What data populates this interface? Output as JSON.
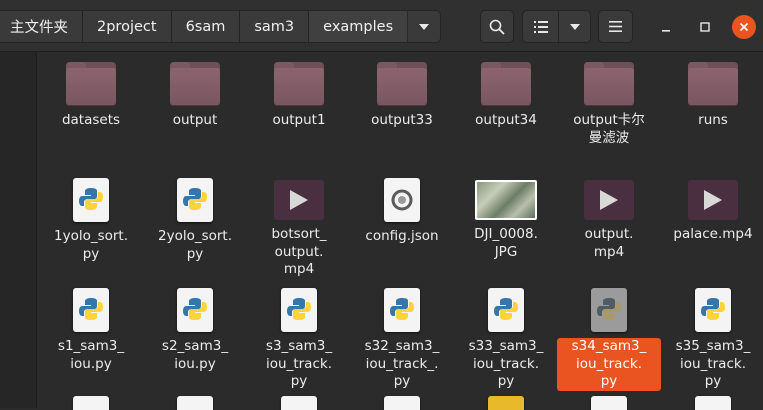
{
  "breadcrumb": {
    "items": [
      "主文件夹",
      "2project",
      "6sam",
      "sam3",
      "examples"
    ]
  },
  "toolbar": {
    "search_icon": "search-icon",
    "view_icon": "list-view-icon",
    "view_menu_icon": "chevron-down-icon",
    "menu_icon": "hamburger-menu-icon"
  },
  "window": {
    "close_color": "#e95420"
  },
  "files": {
    "row1": [
      {
        "name": "datasets",
        "type": "folder"
      },
      {
        "name": "output",
        "type": "folder"
      },
      {
        "name": "output1",
        "type": "folder"
      },
      {
        "name": "output33",
        "type": "folder"
      },
      {
        "name": "output34",
        "type": "folder"
      },
      {
        "name": "output卡尔曼滤波",
        "type": "folder"
      },
      {
        "name": "runs",
        "type": "folder"
      }
    ],
    "row2": [
      {
        "name": "1yolo_sort.py",
        "type": "python"
      },
      {
        "name": "2yolo_sort.py",
        "type": "python"
      },
      {
        "name": "botsort_output.mp4",
        "type": "video"
      },
      {
        "name": "config.json",
        "type": "json"
      },
      {
        "name": "DJI_0008.JPG",
        "type": "image"
      },
      {
        "name": "output.mp4",
        "type": "video"
      },
      {
        "name": "palace.mp4",
        "type": "video"
      }
    ],
    "row3": [
      {
        "name": "s1_sam3_iou.py",
        "type": "python"
      },
      {
        "name": "s2_sam3_iou.py",
        "type": "python"
      },
      {
        "name": "s3_sam3_iou_track.py",
        "type": "python"
      },
      {
        "name": "s32_sam3_iou_track_.py",
        "type": "python"
      },
      {
        "name": "s33_sam3_iou_track.py",
        "type": "python"
      },
      {
        "name": "s34_sam3_iou_track.py",
        "type": "python",
        "selected": true
      },
      {
        "name": "s35_sam3_iou_track.py",
        "type": "python"
      }
    ]
  },
  "labels": {
    "r1": [
      "datasets",
      "output",
      "output1",
      "output33",
      "output34",
      "output卡尔\n曼滤波",
      "runs"
    ],
    "r2": [
      "1yolo_sort.\npy",
      "2yolo_sort.\npy",
      "botsort_\noutput.\nmp4",
      "config.json",
      "DJI_0008.\nJPG",
      "output.\nmp4",
      "palace.mp4"
    ],
    "r3": [
      "s1_sam3_\niou.py",
      "s2_sam3_\niou.py",
      "s3_sam3_\niou_track.\npy",
      "s32_sam3_\niou_track_.\npy",
      "s33_sam3_\niou_track.\npy",
      "s34_sam3_\niou_track.\npy",
      "s35_sam3_\niou_track.\npy"
    ]
  }
}
